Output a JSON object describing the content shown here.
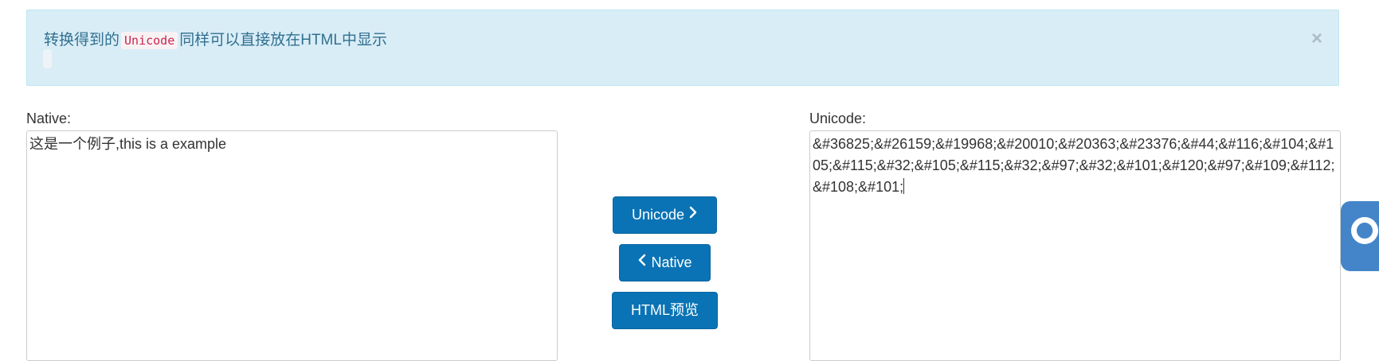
{
  "alert": {
    "text_before": "转换得到的",
    "code": "Unicode",
    "text_after": "同样可以直接放在HTML中显示",
    "close": "×"
  },
  "native": {
    "label": "Native:",
    "value": "这是一个例子,this is a example"
  },
  "unicode": {
    "label": "Unicode:",
    "value": "&#36825;&#26159;&#19968;&#20010;&#20363;&#23376;&#44;&#116;&#104;&#105;&#115;&#32;&#105;&#115;&#32;&#97;&#32;&#101;&#120;&#97;&#109;&#112;&#108;&#101;"
  },
  "buttons": {
    "to_unicode": "Unicode",
    "to_native": "Native",
    "html_preview": "HTML预览"
  },
  "icons": {
    "to_unicode": "chevron-right-icon",
    "to_native": "chevron-left-icon",
    "close": "close-icon",
    "side_widget": "chat-ring-icon"
  },
  "colors": {
    "alert_bg": "#d9edf7",
    "alert_text": "#31708f",
    "button_bg": "#0a73b5",
    "side_widget": "#4385c8"
  }
}
